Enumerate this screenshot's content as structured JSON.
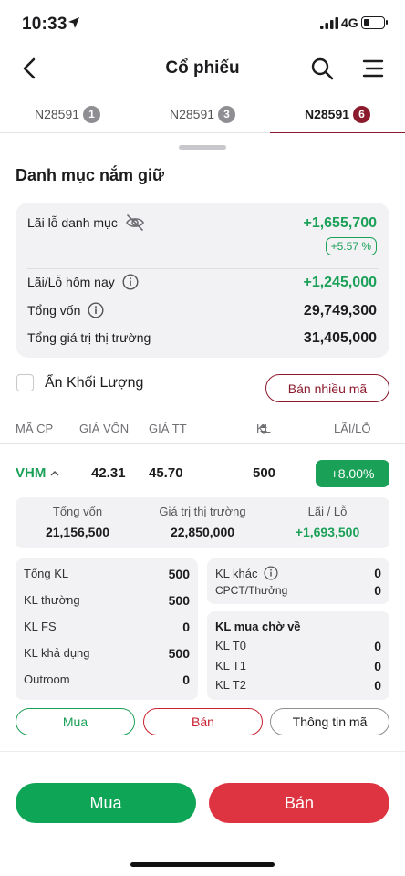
{
  "status_bar": {
    "time": "10:33",
    "network": "4G"
  },
  "nav": {
    "title": "Cổ phiếu"
  },
  "tabs": [
    {
      "label": "N28591",
      "badge": "1"
    },
    {
      "label": "N28591",
      "badge": "3"
    },
    {
      "label": "N28591",
      "badge": "6"
    }
  ],
  "portfolio": {
    "title": "Danh mục nắm giữ",
    "pnl_label": "Lãi lỗ danh mục",
    "pnl_value": "+1,655,700",
    "pnl_percent": "+5.57 %",
    "today_label": "Lãi/Lỗ hôm nay",
    "today_value": "+1,245,000",
    "capital_label": "Tổng vốn",
    "capital_value": "29,749,300",
    "market_label": "Tổng giá trị thị trường",
    "market_value": "31,405,000"
  },
  "controls": {
    "hide_volume_label": "Ẩn Khối Lượng",
    "sell_many_label": "Bán nhiều mã"
  },
  "table": {
    "headers": {
      "symbol": "MÃ CP",
      "cost": "GIÁ VỐN",
      "price": "GIÁ TT",
      "volume": "KL",
      "pnl": "LÃI/LỖ"
    },
    "rows": [
      {
        "symbol": "VHM",
        "cost": "42.31",
        "price": "45.70",
        "volume": "500",
        "pnl": "+8.00%"
      }
    ]
  },
  "detail": {
    "capital_label": "Tổng vốn",
    "capital_value": "21,156,500",
    "market_label": "Giá trị thị trường",
    "market_value": "22,850,000",
    "pnl_label": "Lãi / Lỗ",
    "pnl_value": "+1,693,500",
    "left_card": [
      {
        "k": "Tổng KL",
        "v": "500"
      },
      {
        "k": "KL thường",
        "v": "500"
      },
      {
        "k": "KL FS",
        "v": "0"
      },
      {
        "k": "KL khả dụng",
        "v": "500"
      },
      {
        "k": "Outroom",
        "v": "0"
      }
    ],
    "right_top": [
      {
        "k": "KL khác",
        "v": "0"
      },
      {
        "k": "CPCT/Thưởng",
        "v": "0"
      }
    ],
    "pending_title": "KL mua chờ về",
    "pending": [
      {
        "k": "KL T0",
        "v": "0"
      },
      {
        "k": "KL T1",
        "v": "0"
      },
      {
        "k": "KL T2",
        "v": "0"
      }
    ],
    "actions": {
      "buy": "Mua",
      "sell": "Bán",
      "info": "Thông tin mã"
    }
  },
  "bottom": {
    "buy": "Mua",
    "sell": "Bán"
  },
  "colors": {
    "green": "#1ba057",
    "red": "#de3340",
    "maroon": "#8b1a2c"
  }
}
